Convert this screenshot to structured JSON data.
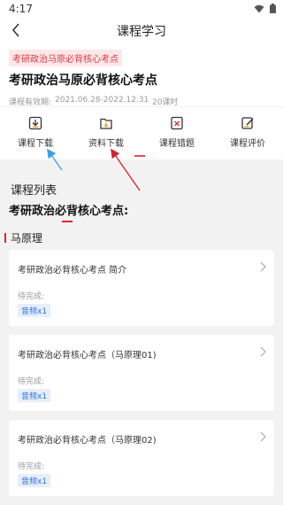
{
  "status_bar": {
    "time": "4:17"
  },
  "nav": {
    "title": "课程学习"
  },
  "course": {
    "tag": "考研政治马原必背核心考点",
    "title": "考研政治马原必背核心考点",
    "validity_label": "课程有效期:",
    "validity_dates": "2021.06.28-2022.12.31",
    "hours": "20课时"
  },
  "actions": [
    {
      "label": "课程下载",
      "icon": "course-download-icon"
    },
    {
      "label": "资料下载",
      "icon": "material-download-icon"
    },
    {
      "label": "课程错题",
      "icon": "wrong-questions-icon"
    },
    {
      "label": "课程评价",
      "icon": "course-review-icon"
    }
  ],
  "list": {
    "section_title": "课程列表",
    "sub_title": "考研政治必背核心考点:",
    "group": "马原理",
    "items": [
      {
        "title": "考研政治必背核心考点 简介",
        "pending": "待完成:",
        "badge": "音频x1"
      },
      {
        "title": "考研政治必背核心考点（马原理01)",
        "pending": "待完成:",
        "badge": "音频x1"
      },
      {
        "title": "考研政治必背核心考点（马原理02)",
        "pending": "待完成:",
        "badge": "音频x1"
      }
    ]
  },
  "colors": {
    "accent_red": "#e0262a",
    "blue_badge": "#2f74d8",
    "arrow_blue": "#3aa0e8",
    "arrow_red": "#d6222b"
  }
}
